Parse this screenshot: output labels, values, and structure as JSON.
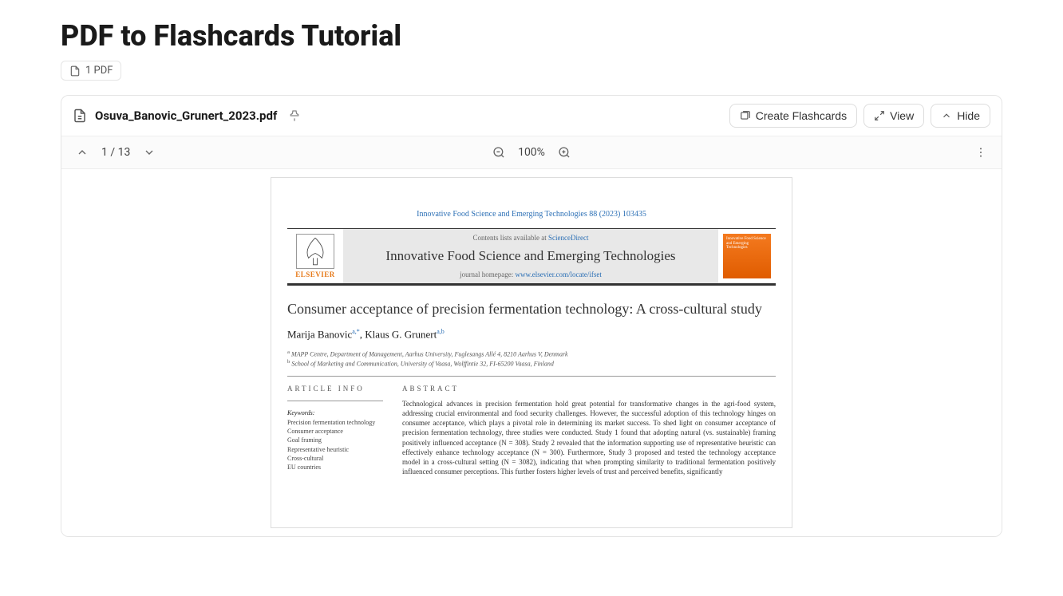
{
  "header": {
    "title": "PDF to Flashcards Tutorial",
    "pdf_count_label": "1 PDF"
  },
  "file": {
    "name": "Osuva_Banovic_Grunert_2023.pdf"
  },
  "actions": {
    "create": "Create Flashcards",
    "view": "View",
    "hide": "Hide"
  },
  "toolbar": {
    "page": "1 / 13",
    "zoom": "100%"
  },
  "doc": {
    "citation": "Innovative Food Science and Emerging Technologies 88 (2023) 103435",
    "science_direct_prefix": "Contents lists available at ",
    "science_direct": "ScienceDirect",
    "journal": "Innovative Food Science and Emerging Technologies",
    "homepage_prefix": "journal homepage: ",
    "homepage_url": "www.elsevier.com/locate/ifset",
    "elsevier": "ELSEVIER",
    "title": "Consumer acceptance of precision fermentation technology: A cross-cultural study",
    "author1": "Marija Banovic",
    "author1_sup": "a,*",
    "author2": "Klaus G. Grunert",
    "author2_sup": "a,b",
    "affil_a": "MAPP Centre, Department of Management, Aarhus University, Fuglesangs Allé 4, 8210 Aarhus V, Denmark",
    "affil_b": "School of Marketing and Communication, University of Vaasa, Wolffintie 32, FI-65200 Vaasa, Finland",
    "article_info": "ARTICLE INFO",
    "abstract_h": "ABSTRACT",
    "keywords_h": "Keywords:",
    "keywords": [
      "Precision fermentation technology",
      "Consumer acceptance",
      "Goal framing",
      "Representative heuristic",
      "Cross-cultural",
      "EU countries"
    ],
    "abstract": "Technological advances in precision fermentation hold great potential for transformative changes in the agri-food system, addressing crucial environmental and food security challenges. However, the successful adoption of this technology hinges on consumer acceptance, which plays a pivotal role in determining its market success. To shed light on consumer acceptance of precision fermentation technology, three studies were conducted. Study 1 found that adopting natural (vs. sustainable) framing positively influenced acceptance (N = 308). Study 2 revealed that the information supporting use of representative heuristic can effectively enhance technology acceptance (N = 300). Furthermore, Study 3 proposed and tested the technology acceptance model in a cross-cultural setting (N = 3082), indicating that when prompting similarity to traditional fermentation positively influenced consumer perceptions. This further fosters higher levels of trust and perceived benefits, significantly"
  }
}
